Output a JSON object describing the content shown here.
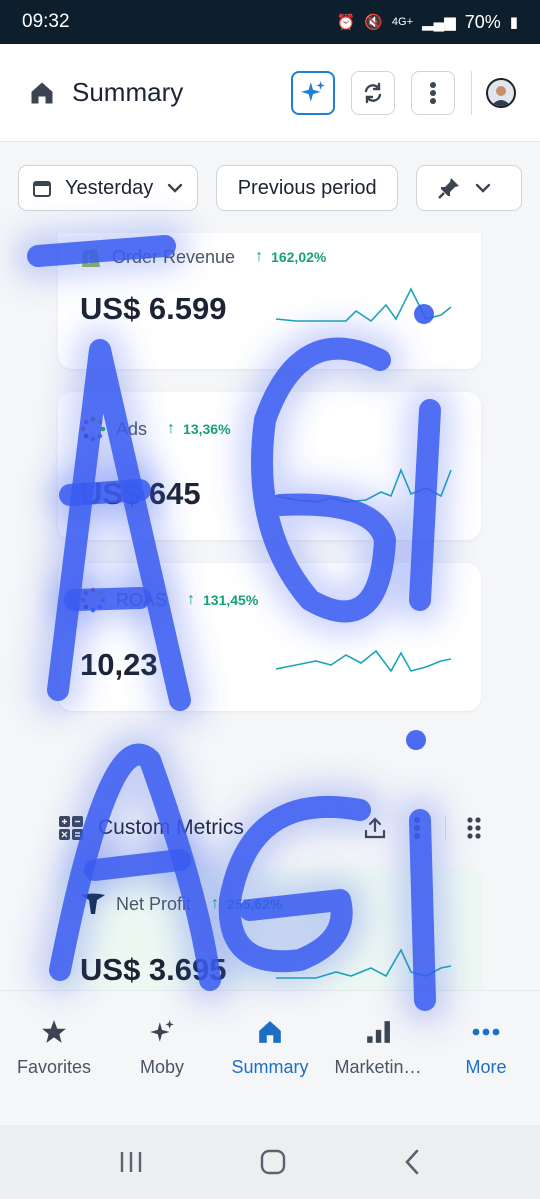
{
  "status": {
    "time": "09:32",
    "battery": "70%",
    "network": "4G+"
  },
  "header": {
    "title": "Summary"
  },
  "filters": {
    "date_range": "Yesterday",
    "compare": "Previous period"
  },
  "metrics": [
    {
      "label": "Order Revenue",
      "change": "162,02%",
      "value": "US$ 6.599",
      "icon": "shopify-icon"
    },
    {
      "label": "Ads",
      "change": "13,36%",
      "value": "US$ 645",
      "icon": "ads-dots-icon"
    },
    {
      "label": "ROAS",
      "change": "131,45%",
      "value": "10,23",
      "icon": "roas-dots-icon"
    }
  ],
  "custom": {
    "title": "Custom Metrics",
    "metric": {
      "label": "Net Profit",
      "change": "255,62%",
      "value": "US$ 3.695",
      "icon": "triple-whale-icon"
    }
  },
  "nav": [
    {
      "label": "Favorites",
      "icon": "star-icon"
    },
    {
      "label": "Moby",
      "icon": "sparkle-icon"
    },
    {
      "label": "Summary",
      "icon": "home-icon",
      "active": true
    },
    {
      "label": "Marketin…",
      "icon": "bar-chart-icon"
    },
    {
      "label": "More",
      "icon": "more-dots-icon"
    }
  ],
  "overlay_text": "AGI AGI",
  "colors": {
    "accent": "#1e6fc4",
    "positive": "#17a177",
    "spark": "#1aa6b7",
    "scribble": "#3a5cf0"
  }
}
